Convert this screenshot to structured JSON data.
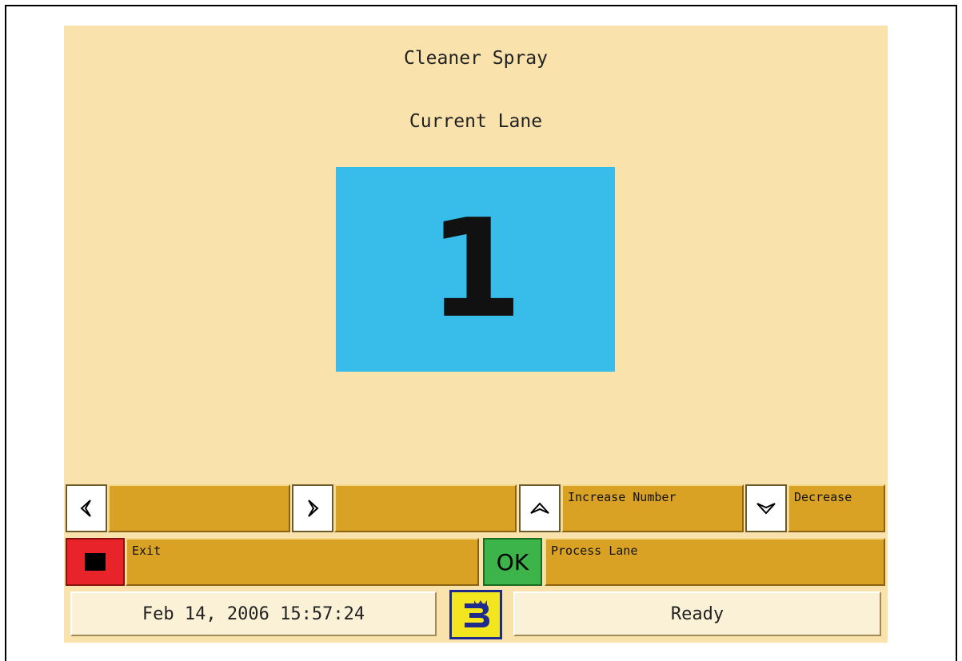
{
  "screen": {
    "title": "Cleaner Spray",
    "subtitle": "Current Lane",
    "lane_number": "1"
  },
  "controls": {
    "left_label": "",
    "right_label": "",
    "increase_label": "Increase Number",
    "decrease_label": "Decrease",
    "exit_label": "Exit",
    "ok_label": "OK",
    "process_label": "Process Lane"
  },
  "statusbar": {
    "datetime": "Feb 14, 2006 15:57:24",
    "status": "Ready"
  },
  "icons": {
    "left": "arrow-left-icon",
    "right": "arrow-right-icon",
    "up": "arrow-up-icon",
    "down": "arrow-down-icon",
    "stop": "stop-icon",
    "logo": "brand-logo-icon"
  },
  "colors": {
    "background": "#fae2ad",
    "lane_box": "#38bdea",
    "button_bar": "#d9a224",
    "stop": "#e8232a",
    "ok": "#3db44a"
  }
}
